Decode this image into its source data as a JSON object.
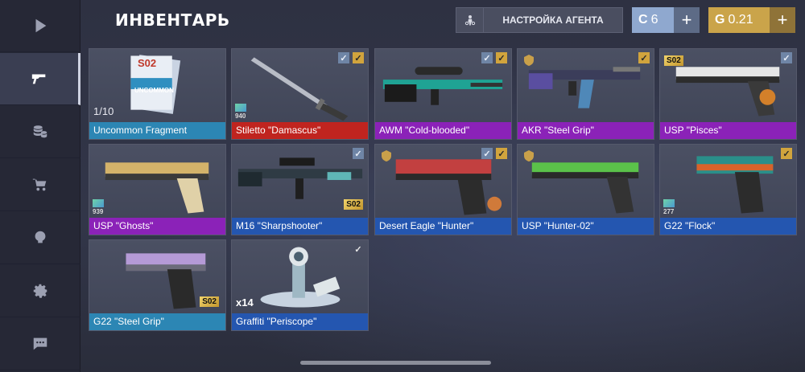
{
  "header": {
    "title": "ИНВЕНТАРЬ",
    "agent_button": "НАСТРОЙКА АГЕНТА",
    "silver": {
      "value": "6",
      "plus": "+"
    },
    "gold": {
      "value": "0.21",
      "plus": "+"
    }
  },
  "sidebar": {
    "items": [
      {
        "icon": "play-icon"
      },
      {
        "icon": "pistol-icon",
        "active": true
      },
      {
        "icon": "coins-icon"
      },
      {
        "icon": "cart-icon"
      },
      {
        "icon": "trophy-icon"
      },
      {
        "icon": "gear-icon"
      },
      {
        "icon": "chat-icon"
      }
    ]
  },
  "items": [
    {
      "name": "Uncommon Fragment",
      "rarity": "uncommon",
      "count": "1/10",
      "art_label": "UNCOMMON",
      "art_tag": "S02"
    },
    {
      "name": "Stiletto \"Damascus\"",
      "rarity": "legend",
      "checks": [
        "b",
        "y"
      ],
      "float": "940"
    },
    {
      "name": "AWM \"Cold-blooded\"",
      "rarity": "rare",
      "checks": [
        "b",
        "y"
      ]
    },
    {
      "name": "AKR \"Steel Grip\"",
      "rarity": "rare",
      "checks": [
        "y"
      ]
    },
    {
      "name": "USP \"Pisces\"",
      "rarity": "rare",
      "checks": [
        "b"
      ],
      "tag": "S02"
    },
    {
      "name": "USP \"Ghosts\"",
      "rarity": "rare",
      "float": "939"
    },
    {
      "name": "M16 \"Sharpshooter\"",
      "rarity": "blue",
      "checks": [
        "b"
      ],
      "tag": "S02"
    },
    {
      "name": "Desert Eagle \"Hunter\"",
      "rarity": "blue",
      "checks": [
        "b",
        "y"
      ]
    },
    {
      "name": "USP \"Hunter-02\"",
      "rarity": "blue"
    },
    {
      "name": "G22 \"Flock\"",
      "rarity": "blue",
      "checks": [
        "y"
      ],
      "float": "277"
    },
    {
      "name": "G22 \"Steel Grip\"",
      "rarity": "uncommon",
      "tag": "S02"
    },
    {
      "name": "Graffiti \"Periscope\"",
      "rarity": "blue",
      "checks": [
        "w"
      ],
      "qty": "x14"
    }
  ]
}
